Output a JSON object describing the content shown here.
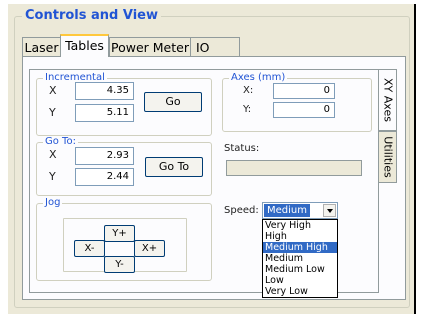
{
  "window": {
    "group_title": "Controls and View"
  },
  "tabs": [
    {
      "label": "Laser",
      "active": false
    },
    {
      "label": "Tables",
      "active": true
    },
    {
      "label": "Power Meter",
      "active": false
    },
    {
      "label": "IO",
      "active": false
    }
  ],
  "side_tabs": [
    {
      "label": "XY Axes",
      "active": true
    },
    {
      "label": "Utilities",
      "active": false
    }
  ],
  "incremental": {
    "title": "Incremental",
    "x_label": "X",
    "x_value": "4.35",
    "y_label": "Y",
    "y_value": "5.11",
    "go_label": "Go"
  },
  "goto": {
    "title": "Go To:",
    "x_label": "X",
    "x_value": "2.93",
    "y_label": "Y",
    "y_value": "2.44",
    "go_label": "Go To"
  },
  "jog": {
    "title": "Jog",
    "y_plus": "Y+",
    "x_minus": "X-",
    "x_plus": "X+",
    "y_minus": "Y-"
  },
  "axes": {
    "title": "Axes (mm)",
    "x_label": "X:",
    "x_value": "0",
    "y_label": "Y:",
    "y_value": "0"
  },
  "status": {
    "label": "Status:",
    "value": ""
  },
  "speed": {
    "label": "Speed:",
    "selected": "Medium",
    "options": [
      "Very High",
      "High",
      "Medium High",
      "Medium",
      "Medium Low",
      "Low",
      "Very Low"
    ],
    "highlighted_option": "Medium High"
  },
  "colors": {
    "group_title": "#2154d4",
    "selection": "#316ac5",
    "active_tab_accent": "#ffc83c",
    "dialog_bg": "#ece9d8"
  }
}
